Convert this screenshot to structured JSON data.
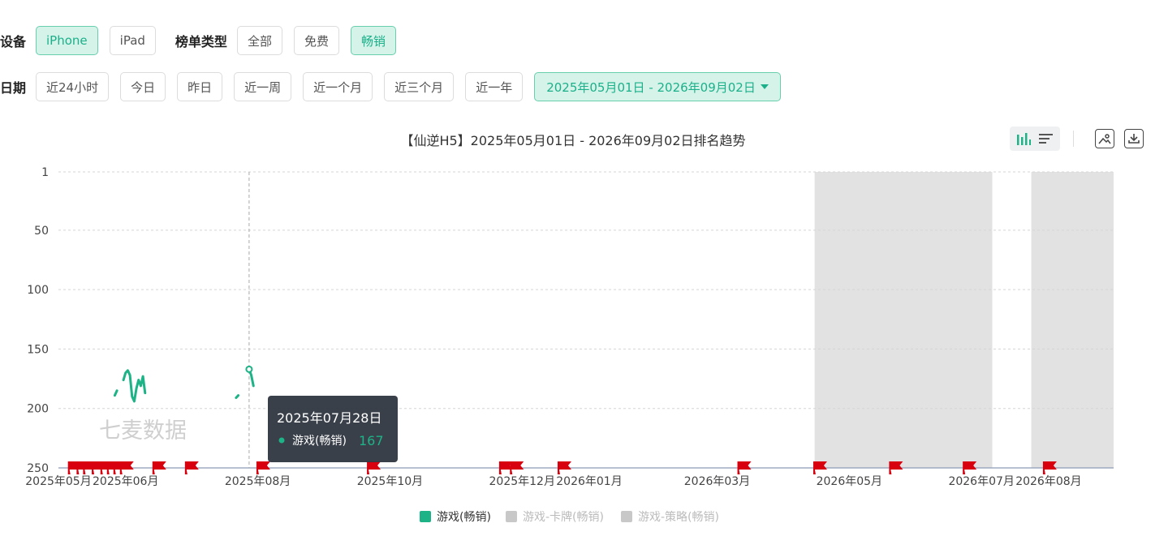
{
  "filters": {
    "device_label": "设备",
    "devices": [
      {
        "label": "iPhone",
        "active": true
      },
      {
        "label": "iPad",
        "active": false
      }
    ],
    "list_type_label": "榜单类型",
    "list_types": [
      {
        "label": "全部",
        "active": false
      },
      {
        "label": "免费",
        "active": false
      },
      {
        "label": "畅销",
        "active": true
      }
    ],
    "date_label": "日期",
    "date_presets": [
      "近24小时",
      "今日",
      "昨日",
      "近一周",
      "近一个月",
      "近三个月",
      "近一年"
    ],
    "date_range": "2025年05月01日 - 2026年09月02日"
  },
  "chart_data": {
    "type": "line",
    "title": "【仙逆H5】2025年05月01日 - 2026年09月02日排名趋势",
    "x_axis": {
      "start": "2025-05-01",
      "end": "2026-08-31",
      "tick_labels": [
        {
          "date": "2025-05-01",
          "label": "2025年05月"
        },
        {
          "date": "2025-06-01",
          "label": "2025年06月"
        },
        {
          "date": "2025-08-01",
          "label": "2025年08月"
        },
        {
          "date": "2025-10-01",
          "label": "2025年10月"
        },
        {
          "date": "2025-12-01",
          "label": "2025年12月"
        },
        {
          "date": "2026-01-01",
          "label": "2026年01月"
        },
        {
          "date": "2026-03-01",
          "label": "2026年03月"
        },
        {
          "date": "2026-05-01",
          "label": "2026年05月"
        },
        {
          "date": "2026-07-01",
          "label": "2026年07月"
        },
        {
          "date": "2026-08-01",
          "label": "2026年08月"
        }
      ]
    },
    "y_axis": {
      "inverted": true,
      "range": [
        1,
        250
      ],
      "ticks": [
        1,
        50,
        100,
        150,
        200,
        250
      ]
    },
    "grid": true,
    "series": [
      {
        "name": "游戏(畅销)",
        "color": "#1db386",
        "points": [
          [
            "2025-05-27",
            189
          ],
          [
            "2025-05-28",
            185
          ],
          [
            "2025-05-31",
            176
          ],
          [
            "2025-06-01",
            170
          ],
          [
            "2025-06-02",
            168
          ],
          [
            "2025-06-03",
            172
          ],
          [
            "2025-06-04",
            190
          ],
          [
            "2025-06-05",
            194
          ],
          [
            "2025-06-06",
            183
          ],
          [
            "2025-06-07",
            176
          ],
          [
            "2025-06-08",
            181
          ],
          [
            "2025-06-09",
            173
          ],
          [
            "2025-06-10",
            187
          ],
          [
            "2025-07-22",
            191
          ],
          [
            "2025-07-23",
            189
          ],
          [
            "2025-07-28",
            167
          ],
          [
            "2025-07-29",
            172
          ],
          [
            "2025-07-30",
            181
          ]
        ]
      },
      {
        "name": "游戏-卡牌(畅销)",
        "color": "#c8c8c8",
        "points": []
      },
      {
        "name": "游戏-策略(畅销)",
        "color": "#c8c8c8",
        "points": []
      }
    ],
    "shaded_ranges": [
      [
        "2026-04-15",
        "2026-07-06"
      ],
      [
        "2026-07-24",
        "2026-08-31"
      ]
    ],
    "event_flags": [
      "2025-05-08",
      "2025-05-12",
      "2025-05-15",
      "2025-05-19",
      "2025-05-23",
      "2025-05-26",
      "2025-05-29",
      "2025-06-01",
      "2025-06-16",
      "2025-07-01",
      "2025-08-03",
      "2025-09-23",
      "2025-11-23",
      "2025-11-28",
      "2025-12-20",
      "2026-03-13",
      "2026-04-17",
      "2026-05-22",
      "2026-06-25",
      "2026-08-01"
    ],
    "tooltip": {
      "date": "2025年07月28日",
      "series": "游戏(畅销)",
      "value": 167
    },
    "legend": [
      "游戏(畅销)",
      "游戏-卡牌(畅销)",
      "游戏-策略(畅销)"
    ],
    "legend_position": "bottom",
    "watermark": "七麦数据"
  },
  "toolbar": {
    "icons": [
      "bar-chart-icon",
      "list-icon",
      "image-icon",
      "download-icon"
    ]
  }
}
